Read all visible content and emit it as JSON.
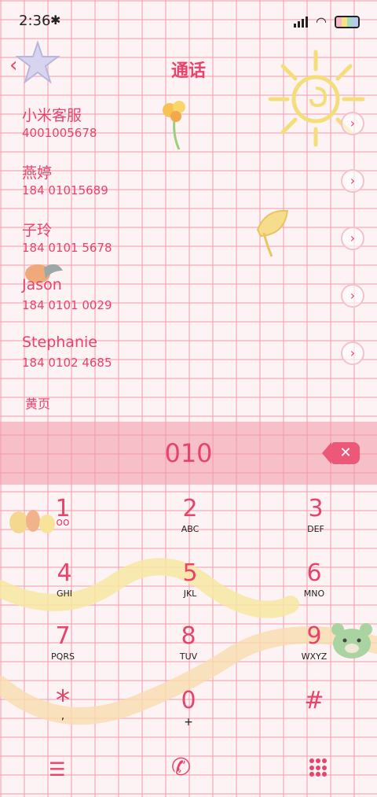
{
  "status": {
    "time": "2:36",
    "bluetooth_icon": "bluetooth-icon",
    "signal_icon": "signal-icon",
    "wifi_icon": "wifi-icon",
    "battery_icon": "battery-icon"
  },
  "header": {
    "title": "通话",
    "back_icon": "back-chevron-icon"
  },
  "contacts": [
    {
      "name": "小米客服",
      "number": "4001005678"
    },
    {
      "name": "燕婷",
      "number": "184 01015689"
    },
    {
      "name": "子玲",
      "number": "184 0101 5678"
    },
    {
      "name": "Jason",
      "number": "184 0101 0029"
    },
    {
      "name": "Stephanie",
      "number": "184 0102 4685"
    }
  ],
  "yellow_pages": "黄页",
  "dial": {
    "value": "010",
    "delete_icon": "backspace-icon"
  },
  "keys": [
    {
      "digit": "1",
      "letters": "oo"
    },
    {
      "digit": "2",
      "letters": "ABC"
    },
    {
      "digit": "3",
      "letters": "DEF"
    },
    {
      "digit": "4",
      "letters": "GHI"
    },
    {
      "digit": "5",
      "letters": "JKL"
    },
    {
      "digit": "6",
      "letters": "MNO"
    },
    {
      "digit": "7",
      "letters": "PQRS"
    },
    {
      "digit": "8",
      "letters": "TUV"
    },
    {
      "digit": "9",
      "letters": "WXYZ"
    },
    {
      "digit": "*",
      "letters": ","
    },
    {
      "digit": "0",
      "letters": "+"
    },
    {
      "digit": "#",
      "letters": ""
    }
  ],
  "bottom": {
    "menu_icon": "menu-icon",
    "call_icon": "phone-call-icon",
    "keypad_icon": "keypad-icon"
  },
  "colors": {
    "accent": "#e8436b",
    "dialbar": "#f296a5",
    "background": "#fdf3f4"
  }
}
